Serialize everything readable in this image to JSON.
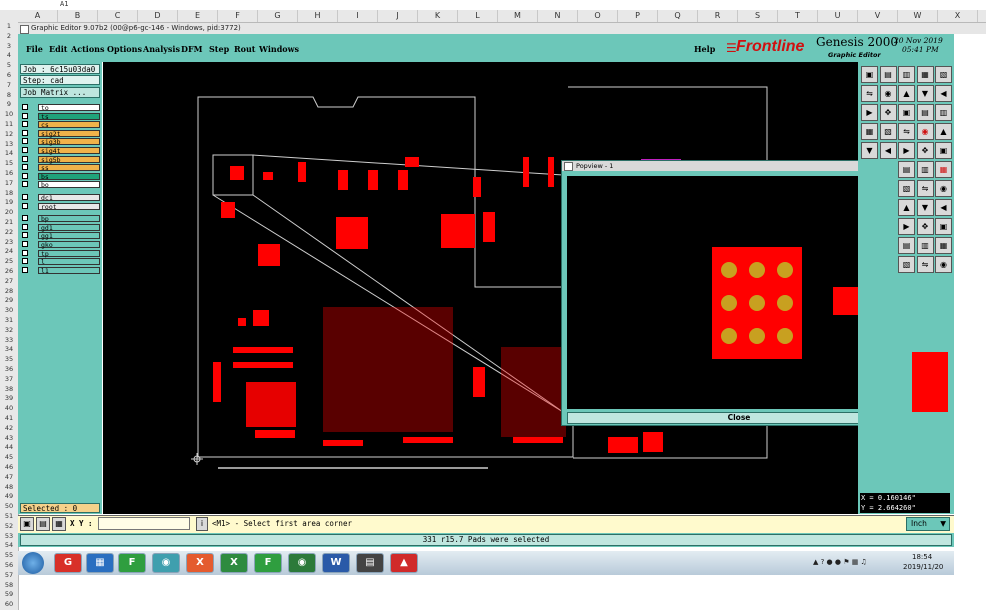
{
  "sheet": {
    "name_box": "A1",
    "columns": [
      "A",
      "B",
      "C",
      "D",
      "E",
      "F",
      "G",
      "H",
      "I",
      "J",
      "K",
      "L",
      "M",
      "N",
      "O",
      "P",
      "Q",
      "R",
      "S",
      "T",
      "U",
      "V",
      "W",
      "X"
    ],
    "rows": [
      "1",
      "2",
      "3",
      "4",
      "5",
      "6",
      "7",
      "8",
      "9",
      "10",
      "11",
      "12",
      "13",
      "14",
      "15",
      "16",
      "17",
      "18",
      "19",
      "20",
      "21",
      "22",
      "23",
      "24",
      "25",
      "26",
      "27",
      "28",
      "29",
      "30",
      "31",
      "32",
      "33",
      "34",
      "35",
      "36",
      "37",
      "38",
      "39",
      "40",
      "41",
      "42",
      "43",
      "44",
      "45",
      "46",
      "47",
      "48",
      "49",
      "50",
      "51",
      "52",
      "53",
      "54",
      "55",
      "56",
      "57",
      "58",
      "59",
      "60"
    ]
  },
  "window": {
    "title": "Graphic Editor 9.07b2 (00@p6-gc-146 - Windows, pid:3772)"
  },
  "menu": {
    "items": [
      "File",
      "Edit",
      "Actions",
      "Options",
      "Analysis",
      "DFM",
      "Step",
      "Rout",
      "Windows"
    ],
    "help": "Help"
  },
  "brand": {
    "logo": "Frontline",
    "product": "Genesis 2000",
    "subtitle": "Graphic Editor",
    "date": "20 Nov 2019",
    "time": "05:41 PM"
  },
  "job": {
    "job_label": "Job : 6c15u03da0",
    "step_label": "Step: cad",
    "matrix_button": "Job Matrix ..."
  },
  "layers": [
    {
      "name": "to",
      "color": "#ffffff"
    },
    {
      "name": "ts",
      "color": "#1fa37a"
    },
    {
      "name": "cs",
      "color": "#f0b24a"
    },
    {
      "name": "sig2t",
      "color": "#f0b24a"
    },
    {
      "name": "sig3b",
      "color": "#f0b24a"
    },
    {
      "name": "sig4t",
      "color": "#f0b24a"
    },
    {
      "name": "sig5b",
      "color": "#f0b24a"
    },
    {
      "name": "ss",
      "color": "#f0b24a"
    },
    {
      "name": "bs",
      "color": "#1fa37a"
    },
    {
      "name": "bo",
      "color": "#ffffff"
    },
    {
      "name": "dc1",
      "color": "#e8e8e8"
    },
    {
      "name": "root",
      "color": "#e8e8e8"
    },
    {
      "name": "bp",
      "color": "#6cc7b9"
    },
    {
      "name": "gd1",
      "color": "#6cc7b9"
    },
    {
      "name": "gg1",
      "color": "#6cc7b9"
    },
    {
      "name": "gko",
      "color": "#6cc7b9"
    },
    {
      "name": "tp",
      "color": "#6cc7b9"
    },
    {
      "name": "l",
      "color": "#6cc7b9"
    },
    {
      "name": "l1",
      "color": "#6cc7b9"
    }
  ],
  "selected_label": "Selected : 0",
  "popview": {
    "title": "Popview - 1",
    "close_button": "Close"
  },
  "coords": {
    "x": "X = 0.160146\"",
    "y": "Y = 2.664260\""
  },
  "command": {
    "xy_label": "X Y :",
    "prompt": "<M1> - Select first area corner",
    "units": "Inch"
  },
  "status": "331 r15.7 Pads were selected",
  "taskbar": {
    "time": "18:54",
    "date": "2019/11/20"
  },
  "colors": {
    "teal": "#6cc7b9",
    "pad_red": "#ff0000",
    "canvas": "#000000",
    "drill": "#c8a020"
  }
}
